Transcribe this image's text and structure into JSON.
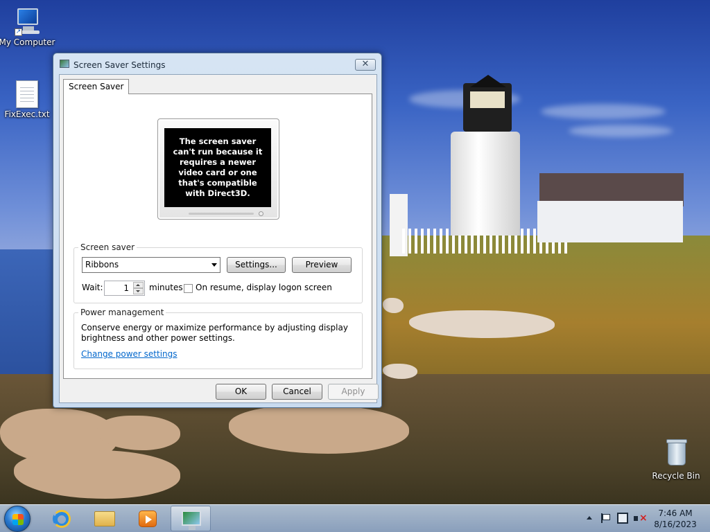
{
  "desktop": {
    "icons": [
      {
        "label": "My Computer"
      },
      {
        "label": "FixExec.txt"
      },
      {
        "label": "Recycle Bin"
      }
    ]
  },
  "dialog": {
    "title": "Screen Saver Settings",
    "close_symbol": "✕",
    "tab_label": "Screen Saver",
    "preview_message": "The screen saver can't run because it requires a newer video card or one that's compatible with Direct3D.",
    "screen_saver_group": {
      "label": "Screen saver",
      "selected": "Ribbons",
      "settings_label": "Settings...",
      "preview_label": "Preview",
      "wait_label": "Wait:",
      "wait_value": "1",
      "minutes_label": "minutes",
      "resume_logon_label": "On resume, display logon screen",
      "resume_logon_checked": false
    },
    "power_group": {
      "label": "Power management",
      "description": "Conserve energy or maximize performance by adjusting display brightness and other power settings.",
      "link_label": "Change power settings"
    },
    "buttons": {
      "ok": "OK",
      "cancel": "Cancel",
      "apply": "Apply"
    }
  },
  "taskbar": {
    "pinned": [
      {
        "icon": "internet-explorer-icon"
      },
      {
        "icon": "file-explorer-icon"
      },
      {
        "icon": "media-player-icon"
      },
      {
        "icon": "display-settings-icon",
        "active": true
      }
    ],
    "clock": {
      "time": "7:46 AM",
      "date": "8/16/2023"
    }
  },
  "colors": {
    "link": "#0066cc",
    "dialog_frame": "#c9dbef"
  }
}
